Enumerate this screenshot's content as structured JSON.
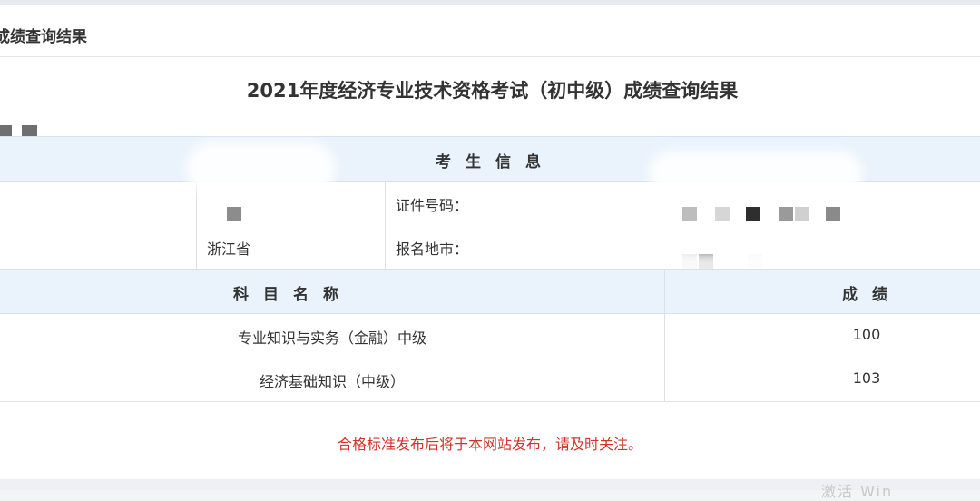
{
  "breadcrumb": "成绩查询结果",
  "page_title": "2021年度经济专业技术资格考试（初中级）成绩查询结果",
  "candidate_section_title": "考生信息",
  "candidate_info": {
    "province_value": "浙江省",
    "id_label": "证件号码：",
    "city_label": "报名地市："
  },
  "subjects_table": {
    "headers": {
      "subject": "科目名称",
      "score": "成绩"
    },
    "rows": [
      {
        "subject": "专业知识与实务（金融）中级",
        "score": "100"
      },
      {
        "subject": "经济基础知识（中级）",
        "score": "103"
      }
    ]
  },
  "notice": "合格标准发布后将于本网站发布，请及时关注。",
  "watermark": "激活 Win",
  "colors": {
    "header_band": "#eaf3fb",
    "notice": "#d0342c",
    "mask": "#6f6f6f"
  }
}
